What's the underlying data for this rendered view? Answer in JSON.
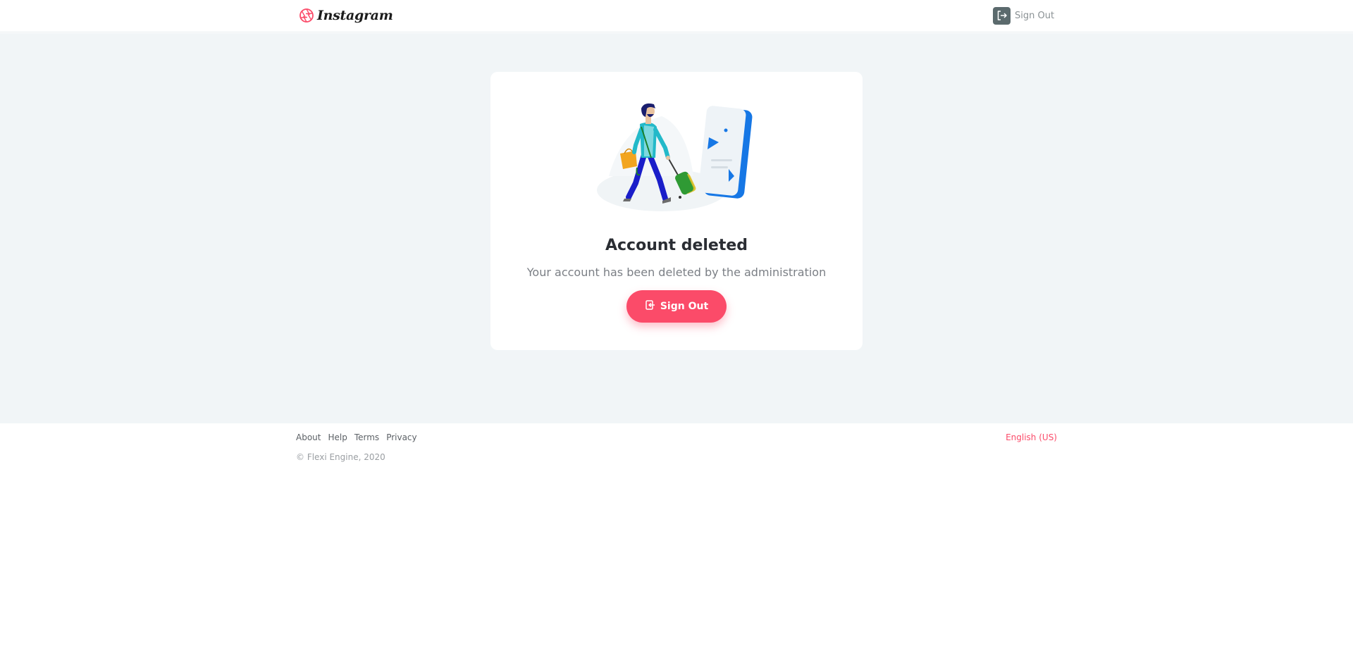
{
  "brand": {
    "name": "Instagram",
    "logo_icon": "instagram-aperture-icon",
    "accent_color": "#fb4b69"
  },
  "header": {
    "signout_label": "Sign Out",
    "signout_icon": "exit-icon"
  },
  "card": {
    "illustration": "traveler-with-luggage-and-phone",
    "title": "Account deleted",
    "subtitle": "Your account has been deleted by the administration",
    "button_label": "Sign Out",
    "button_icon": "exit-icon"
  },
  "footer": {
    "links": [
      {
        "label": "About"
      },
      {
        "label": "Help"
      },
      {
        "label": "Terms"
      },
      {
        "label": "Privacy"
      }
    ],
    "copyright": "© Flexi Engine, 2020",
    "language": "English (US)"
  }
}
